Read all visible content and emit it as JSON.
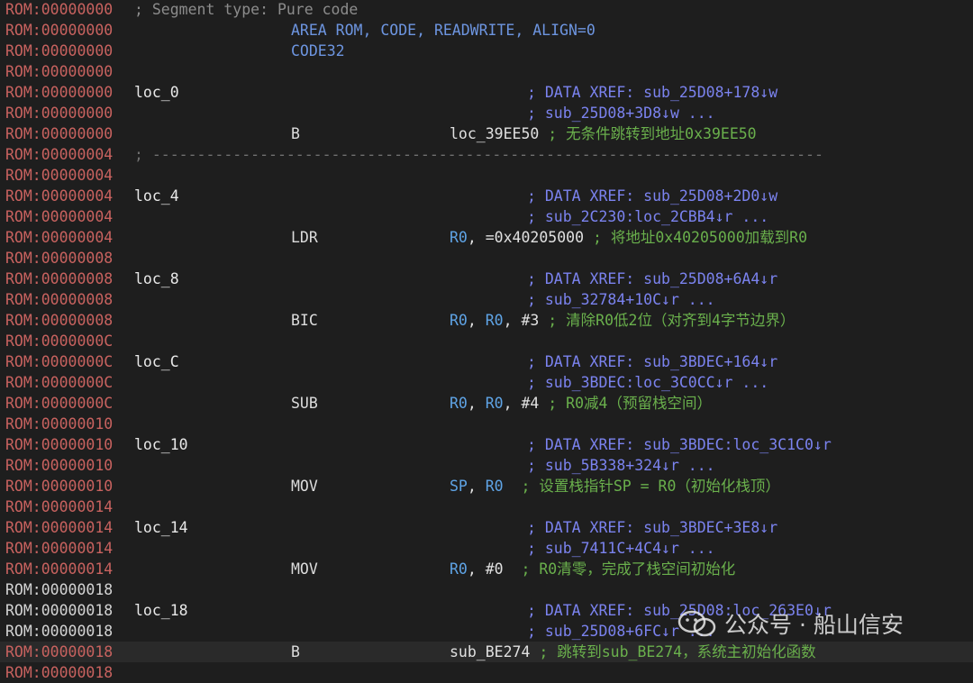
{
  "addr_prefix": "ROM:",
  "segment_comment": "; Segment type: Pure code",
  "separator": "; ---------------------------------------------------------------------------",
  "watermark": "公众号 · 船山信安",
  "lines": [
    {
      "addr": "00000000",
      "kind": "segcmt"
    },
    {
      "addr": "00000000",
      "kind": "directive",
      "mnemonic": "AREA ROM, CODE, READWRITE, ALIGN=0"
    },
    {
      "addr": "00000000",
      "kind": "directive",
      "mnemonic": "CODE32"
    },
    {
      "addr": "00000000",
      "kind": "blank"
    },
    {
      "addr": "00000000",
      "kind": "label",
      "label": "loc_0",
      "xref": "; DATA XREF: sub_25D08+178↓w"
    },
    {
      "addr": "00000000",
      "kind": "xref",
      "xref": "; sub_25D08+3D8↓w ..."
    },
    {
      "addr": "00000000",
      "kind": "insn",
      "mnemonic": "B",
      "operands": [
        {
          "t": "loc_39EE50",
          "c": "plain"
        }
      ],
      "comment": " ; 无条件跳转到地址0x39EE50"
    },
    {
      "addr": "00000004",
      "kind": "sep"
    },
    {
      "addr": "00000004",
      "kind": "blank"
    },
    {
      "addr": "00000004",
      "kind": "label",
      "label": "loc_4",
      "xref": "; DATA XREF: sub_25D08+2D0↓w"
    },
    {
      "addr": "00000004",
      "kind": "xref",
      "xref": "; sub_2C230:loc_2CBB4↓r ..."
    },
    {
      "addr": "00000004",
      "kind": "insn",
      "mnemonic": "LDR",
      "operands": [
        {
          "t": "R0",
          "c": "reg"
        },
        {
          "t": ", =0x40205000",
          "c": "plain"
        }
      ],
      "comment": " ; 将地址0x40205000加载到R0"
    },
    {
      "addr": "00000008",
      "kind": "blank"
    },
    {
      "addr": "00000008",
      "kind": "label",
      "label": "loc_8",
      "xref": "; DATA XREF: sub_25D08+6A4↓r"
    },
    {
      "addr": "00000008",
      "kind": "xref",
      "xref": "; sub_32784+10C↓r ..."
    },
    {
      "addr": "00000008",
      "kind": "insn",
      "mnemonic": "BIC",
      "operands": [
        {
          "t": "R0",
          "c": "reg"
        },
        {
          "t": ", ",
          "c": "plain"
        },
        {
          "t": "R0",
          "c": "reg"
        },
        {
          "t": ", #3",
          "c": "plain"
        }
      ],
      "comment": " ; 清除R0低2位（对齐到4字节边界）"
    },
    {
      "addr": "0000000C",
      "kind": "blank"
    },
    {
      "addr": "0000000C",
      "kind": "label",
      "label": "loc_C",
      "xref": "; DATA XREF: sub_3BDEC+164↓r"
    },
    {
      "addr": "0000000C",
      "kind": "xref",
      "xref": "; sub_3BDEC:loc_3C0CC↓r ..."
    },
    {
      "addr": "0000000C",
      "kind": "insn",
      "mnemonic": "SUB",
      "operands": [
        {
          "t": "R0",
          "c": "reg"
        },
        {
          "t": ", ",
          "c": "plain"
        },
        {
          "t": "R0",
          "c": "reg"
        },
        {
          "t": ", #4",
          "c": "plain"
        }
      ],
      "comment": " ; R0减4（预留栈空间）"
    },
    {
      "addr": "00000010",
      "kind": "blank"
    },
    {
      "addr": "00000010",
      "kind": "label",
      "label": "loc_10",
      "xref": "; DATA XREF: sub_3BDEC:loc_3C1C0↓r"
    },
    {
      "addr": "00000010",
      "kind": "xref",
      "xref": "; sub_5B338+324↓r ..."
    },
    {
      "addr": "00000010",
      "kind": "insn",
      "mnemonic": "MOV",
      "operands": [
        {
          "t": "SP",
          "c": "reg"
        },
        {
          "t": ", ",
          "c": "plain"
        },
        {
          "t": "R0",
          "c": "reg"
        }
      ],
      "comment": "  ; 设置栈指针SP = R0（初始化栈顶）"
    },
    {
      "addr": "00000014",
      "kind": "blank"
    },
    {
      "addr": "00000014",
      "kind": "label",
      "label": "loc_14",
      "xref": "; DATA XREF: sub_3BDEC+3E8↓r"
    },
    {
      "addr": "00000014",
      "kind": "xref",
      "xref": "; sub_7411C+4C4↓r ..."
    },
    {
      "addr": "00000014",
      "kind": "insn",
      "mnemonic": "MOV",
      "operands": [
        {
          "t": "R0",
          "c": "reg"
        },
        {
          "t": ", #0",
          "c": "plain"
        }
      ],
      "comment": "  ; R0清零，完成了栈空间初始化"
    },
    {
      "addr": "00000018",
      "kind": "blank",
      "addr_style": "black"
    },
    {
      "addr": "00000018",
      "kind": "label",
      "label": "loc_18",
      "xref": "; DATA XREF: sub_25D08:loc_263E0↓r",
      "addr_style": "black"
    },
    {
      "addr": "00000018",
      "kind": "xref",
      "xref": "; sub_25D08+6FC↓r ...",
      "addr_style": "black"
    },
    {
      "addr": "00000018",
      "kind": "insn",
      "mnemonic": "B",
      "operands": [
        {
          "t": "sub_BE274",
          "c": "plain"
        }
      ],
      "comment": " ; 跳转到sub_BE274，系统主初始化函数",
      "current": true
    },
    {
      "addr": "00000018",
      "kind": "blank"
    }
  ]
}
